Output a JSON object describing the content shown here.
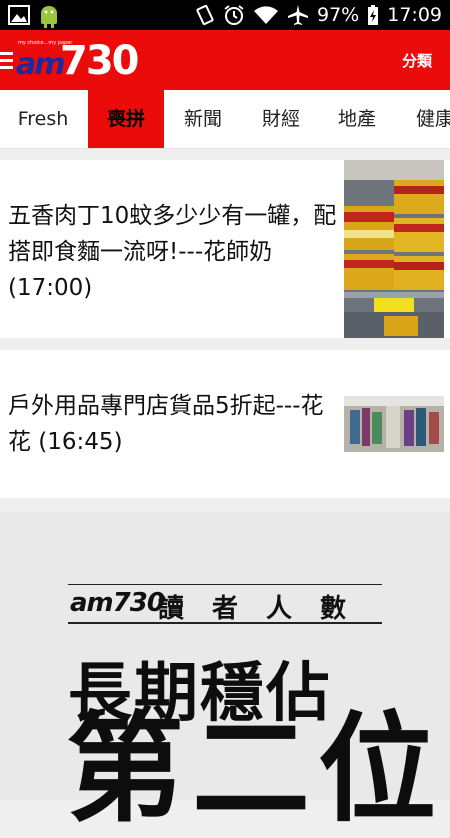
{
  "status": {
    "battery": "97%",
    "time": "17:09"
  },
  "app": {
    "logo_tagline": "my choice...my paper",
    "logo_am": "am",
    "logo_number": "730",
    "category_button": "分類"
  },
  "tabs": [
    {
      "label": "Fresh"
    },
    {
      "label": "喪拼"
    },
    {
      "label": "新聞"
    },
    {
      "label": "財經"
    },
    {
      "label": "地產"
    },
    {
      "label": "健康"
    }
  ],
  "articles": [
    {
      "title": "五香肉丁10蚊多少少有一罐，配搭即食麵一流呀!---花師奶 (17:00)"
    },
    {
      "title": "戶外用品專門店貨品5折起---花花 (16:45)"
    }
  ],
  "ad": {
    "logo": "am730",
    "readers": "讀者人數",
    "headline": "長期穩佔",
    "big": "第二位"
  },
  "colors": {
    "brand_red": "#ec0b0b",
    "logo_blue": "#1d2a9e"
  }
}
